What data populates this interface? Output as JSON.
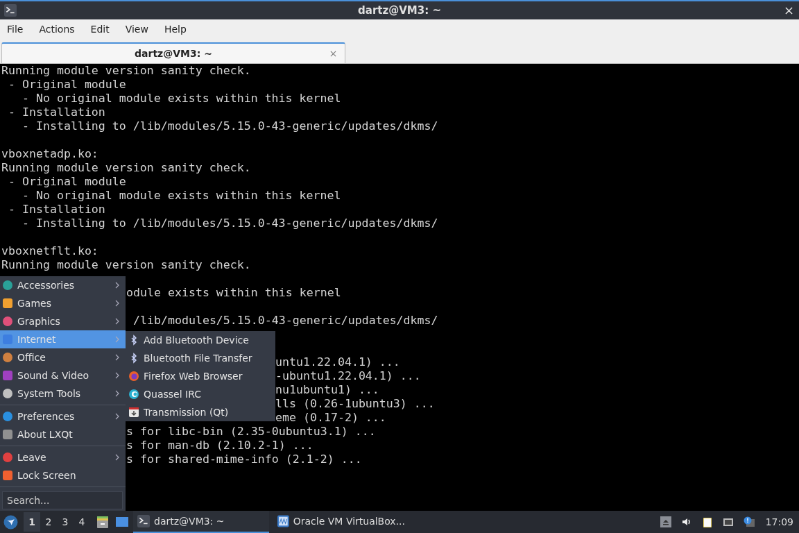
{
  "window": {
    "title": "dartz@VM3: ~"
  },
  "menubar": [
    "File",
    "Actions",
    "Edit",
    "View",
    "Help"
  ],
  "tabs": [
    {
      "label": "dartz@VM3: ~",
      "selected": true
    }
  ],
  "terminal": {
    "lines": [
      {
        "kind": "full",
        "text": "Running module version sanity check."
      },
      {
        "kind": "full",
        "text": " - Original module"
      },
      {
        "kind": "full",
        "text": "   - No original module exists within this kernel"
      },
      {
        "kind": "full",
        "text": " - Installation"
      },
      {
        "kind": "full",
        "text": "   - Installing to /lib/modules/5.15.0-43-generic/updates/dkms/"
      },
      {
        "kind": "blank"
      },
      {
        "kind": "full",
        "text": "vboxnetadp.ko:"
      },
      {
        "kind": "full",
        "text": "Running module version sanity check."
      },
      {
        "kind": "full",
        "text": " - Original module"
      },
      {
        "kind": "full",
        "text": "   - No original module exists within this kernel"
      },
      {
        "kind": "full",
        "text": " - Installation"
      },
      {
        "kind": "full",
        "text": "   - Installing to /lib/modules/5.15.0-43-generic/updates/dkms/"
      },
      {
        "kind": "blank"
      },
      {
        "kind": "full",
        "text": "vboxnetflt.ko:"
      },
      {
        "kind": "full",
        "text": "Running module version sanity check."
      },
      {
        "kind": "blank"
      },
      {
        "kind": "behind_menu",
        "text": "odule exists within this kernel"
      },
      {
        "kind": "blank"
      },
      {
        "kind": "behind_menu",
        "text": " /lib/modules/5.15.0-43-generic/updates/dkms/"
      },
      {
        "kind": "blank"
      },
      {
        "kind": "blank"
      },
      {
        "kind": "behind_submenu",
        "text": "untu1.22.04.1) ..."
      },
      {
        "kind": "behind_submenu",
        "text": "-ubuntu1.22.04.1) ..."
      },
      {
        "kind": "behind_submenu",
        "text": "nu1ubuntu1) ..."
      },
      {
        "kind": "behind_submenu",
        "text": "lls (0.26-1ubuntu3) ..."
      },
      {
        "kind": "behind_submenu",
        "text": "eme (0.17-2) ..."
      },
      {
        "kind": "behind_menu",
        "text": "s for libc-bin (2.35-0ubuntu3.1) ..."
      },
      {
        "kind": "behind_menu",
        "text": "s for man-db (2.10.2-1) ..."
      },
      {
        "kind": "behind_menu",
        "text": "s for shared-mime-info (2.1-2) ..."
      }
    ]
  },
  "app_menu": {
    "groups": [
      [
        {
          "label": "Accessories",
          "selected": false,
          "submenu": true
        },
        {
          "label": "Games",
          "selected": false,
          "submenu": true
        },
        {
          "label": "Graphics",
          "selected": false,
          "submenu": true
        },
        {
          "label": "Internet",
          "selected": true,
          "submenu": true
        },
        {
          "label": "Office",
          "selected": false,
          "submenu": true
        },
        {
          "label": "Sound & Video",
          "selected": false,
          "submenu": true
        },
        {
          "label": "System Tools",
          "selected": false,
          "submenu": true
        }
      ],
      [
        {
          "label": "Preferences",
          "selected": false,
          "submenu": true
        },
        {
          "label": "About LXQt",
          "selected": false,
          "submenu": false
        }
      ],
      [
        {
          "label": "Leave",
          "selected": false,
          "submenu": true
        },
        {
          "label": "Lock Screen",
          "selected": false,
          "submenu": false
        }
      ]
    ],
    "search": {
      "placeholder": "Search..."
    },
    "submenu": [
      "Add Bluetooth Device",
      "Bluetooth File Transfer",
      "Firefox Web Browser",
      "Quassel IRC",
      "Transmission (Qt)"
    ]
  },
  "taskbar": {
    "desktops": [
      {
        "label": "1",
        "selected": true
      },
      {
        "label": "2",
        "selected": false
      },
      {
        "label": "3",
        "selected": false
      },
      {
        "label": "4",
        "selected": false
      }
    ],
    "tasks": [
      {
        "label": "dartz@VM3: ~",
        "selected": true
      },
      {
        "label": "Oracle VM VirtualBox...",
        "selected": false
      }
    ],
    "clock": "17:09"
  }
}
